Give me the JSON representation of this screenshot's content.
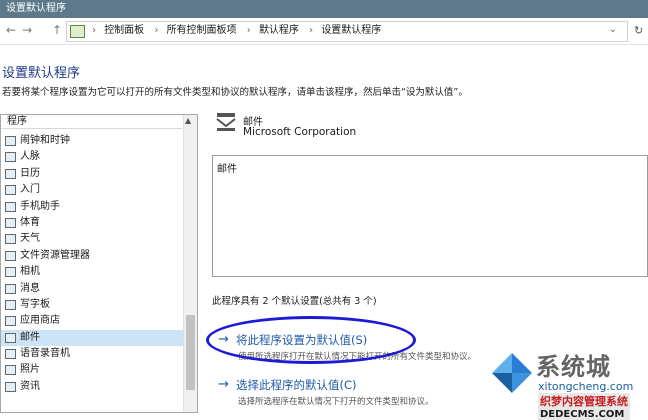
{
  "window": {
    "title": "设置默认程序"
  },
  "nav": {
    "back": "←",
    "forward": "→",
    "up": "↑",
    "breadcrumbs": [
      "控制面板",
      "所有控制面板项",
      "默认程序",
      "设置默认程序"
    ],
    "refresh": "↻"
  },
  "page": {
    "heading": "设置默认程序",
    "description": "若要将某个程序设置为它可以打开的所有文件类型和协议的默认程序，请单击该程序，然后单击“设为默认值”。"
  },
  "program_list": {
    "header": "程序",
    "items": [
      "闹钟和时钟",
      "人脉",
      "日历",
      "入门",
      "手机助手",
      "体育",
      "天气",
      "文件资源管理器",
      "相机",
      "消息",
      "写字板",
      "应用商店",
      "邮件",
      "语音录音机",
      "照片",
      "资讯"
    ],
    "selected": "邮件"
  },
  "selected_app": {
    "name": "邮件",
    "company": "Microsoft Corporation",
    "description": "邮件",
    "defaults_text": "此程序具有 2 个默认设置(总共有 3 个)"
  },
  "actions": {
    "set_default_label": "将此程序设置为默认值(S)",
    "set_default_desc": "使用所选程序打开在默认情况下能打开的所有文件类型和协议。",
    "choose_defaults_label": "选择此程序的默认值(C)",
    "choose_defaults_desc": "选择所选程序在默认情况下打开的文件类型和协议。"
  },
  "watermark": {
    "brand": "系统城",
    "site": "xitongcheng.com",
    "line1": "织梦内容管理系统",
    "line2": "DEDECMS.COM"
  },
  "colors": {
    "link": "#1e5aa8",
    "heading": "#1e3a8a",
    "selection": "#cce4f7",
    "annotation": "#1c1ad6",
    "titlebar": "#5e7a8a"
  }
}
